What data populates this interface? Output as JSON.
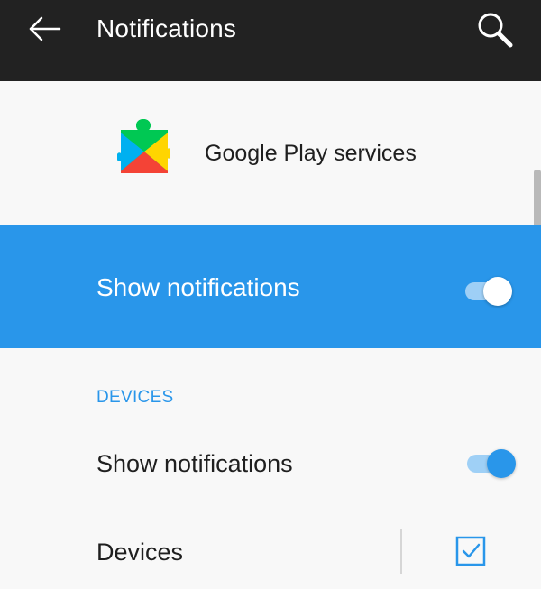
{
  "appbar": {
    "title": "Notifications",
    "back_icon": "arrow-left-icon",
    "search_icon": "search-icon"
  },
  "app": {
    "name": "Google Play services",
    "icon": "google-play-services-icon"
  },
  "master_toggle": {
    "label": "Show notifications",
    "state": "on"
  },
  "section": {
    "header": "DEVICES"
  },
  "rows": [
    {
      "label": "Show notifications",
      "control": "switch",
      "state": "on"
    },
    {
      "label": "Devices",
      "control": "checkbox",
      "checked": true
    }
  ],
  "colors": {
    "appbar_bg": "#222222",
    "accent": "#2996ea",
    "background": "#f8f8f8",
    "text": "#1f1f1f"
  }
}
